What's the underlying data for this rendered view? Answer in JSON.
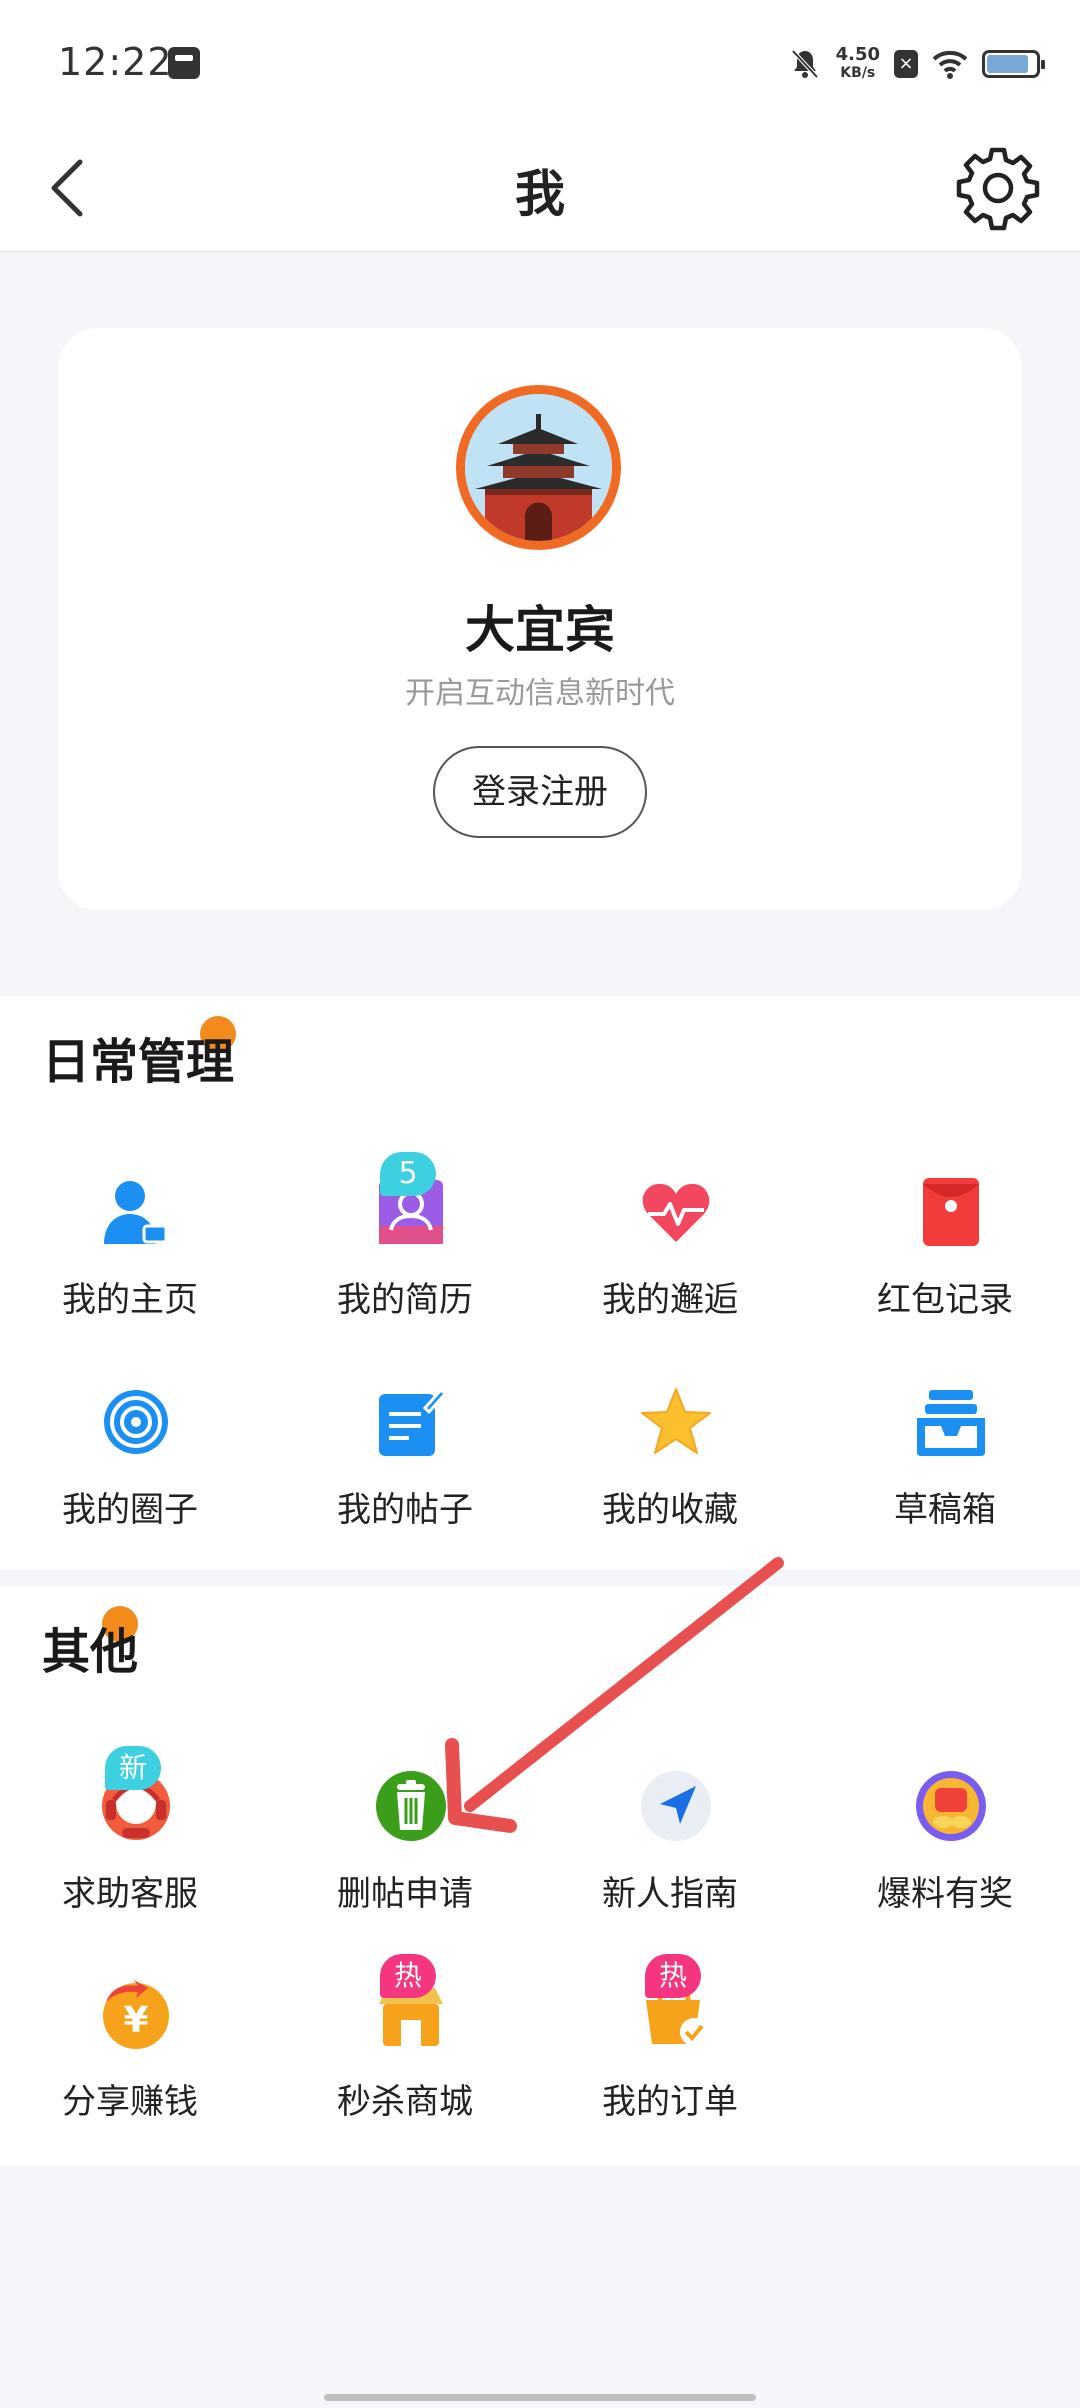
{
  "status_bar": {
    "time": "12:22",
    "speed_value": "4.50",
    "speed_unit": "KB/s",
    "battery_level": 0.85
  },
  "header": {
    "title": "我"
  },
  "profile": {
    "name": "大宜宾",
    "slogan": "开启互动信息新时代",
    "login_label": "登录注册"
  },
  "daily": {
    "title": "日常管理",
    "items": [
      {
        "label": "我的主页",
        "icon": "user-home-icon"
      },
      {
        "label": "我的简历",
        "icon": "resume-icon",
        "badge": "5"
      },
      {
        "label": "我的邂逅",
        "icon": "heart-pulse-icon"
      },
      {
        "label": "红包记录",
        "icon": "red-envelope-icon"
      },
      {
        "label": "我的圈子",
        "icon": "circle-target-icon"
      },
      {
        "label": "我的帖子",
        "icon": "post-edit-icon"
      },
      {
        "label": "我的收藏",
        "icon": "star-icon"
      },
      {
        "label": "草稿箱",
        "icon": "drafts-tray-icon"
      }
    ]
  },
  "other": {
    "title": "其他",
    "items": [
      {
        "label": "求助客服",
        "icon": "customer-service-icon",
        "badge": "新"
      },
      {
        "label": "删帖申请",
        "icon": "trash-icon"
      },
      {
        "label": "新人指南",
        "icon": "navigation-arrow-icon"
      },
      {
        "label": "爆料有奖",
        "icon": "reward-icon"
      },
      {
        "label": "分享赚钱",
        "icon": "share-money-icon"
      },
      {
        "label": "秒杀商城",
        "icon": "flash-sale-shop-icon",
        "badge": "热"
      },
      {
        "label": "我的订单",
        "icon": "order-icon",
        "badge": "热"
      }
    ]
  },
  "colors": {
    "accent_orange": "#f28b1c",
    "avatar_ring": "#f06a23",
    "badge_cyan": "#3dd0e0",
    "badge_pink": "#f5357f",
    "annotation_arrow": "#e85050"
  }
}
